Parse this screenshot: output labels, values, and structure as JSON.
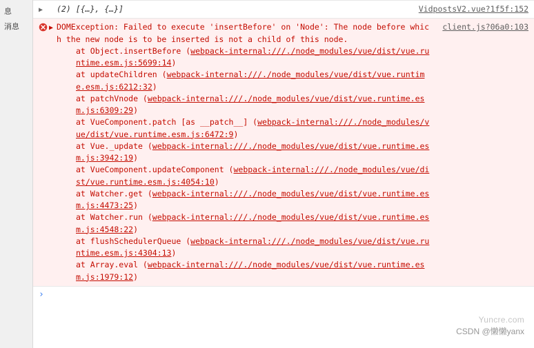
{
  "sidebar": {
    "label_line1": "息",
    "label_line2": "消息"
  },
  "log_row": {
    "count_prefix": "(2)",
    "summary": "[{…}, {…}]",
    "source": "VidpostsV2.vue?1f5f:152"
  },
  "error": {
    "source": "client.js?06a0:103",
    "header_plain": "DOMException: Failed to execute 'insertBefore' on 'Node': The node before which the new node is to be inserted is not a child of this node.",
    "trace": [
      {
        "at": "at Object.insertBefore (",
        "link": "webpack-internal:///./node_modules/vue/dist/vue.runtime.esm.js:5699:14",
        "tail": ")"
      },
      {
        "at": "at updateChildren (",
        "link": "webpack-internal:///./node_modules/vue/dist/vue.runtime.esm.js:6212:32",
        "tail": ")"
      },
      {
        "at": "at patchVnode (",
        "link": "webpack-internal:///./node_modules/vue/dist/vue.runtime.esm.js:6309:29",
        "tail": ")"
      },
      {
        "at": "at VueComponent.patch [as __patch__] (",
        "link": "webpack-internal:///./node_modules/vue/dist/vue.runtime.esm.js:6472:9",
        "tail": ")"
      },
      {
        "at": "at Vue._update (",
        "link": "webpack-internal:///./node_modules/vue/dist/vue.runtime.esm.js:3942:19",
        "tail": ")"
      },
      {
        "at": "at VueComponent.updateComponent (",
        "link": "webpack-internal:///./node_modules/vue/dist/vue.runtime.esm.js:4054:10",
        "tail": ")"
      },
      {
        "at": "at Watcher.get (",
        "link": "webpack-internal:///./node_modules/vue/dist/vue.runtime.esm.js:4473:25",
        "tail": ")"
      },
      {
        "at": "at Watcher.run (",
        "link": "webpack-internal:///./node_modules/vue/dist/vue.runtime.esm.js:4548:22",
        "tail": ")"
      },
      {
        "at": "at flushSchedulerQueue (",
        "link": "webpack-internal:///./node_modules/vue/dist/vue.runtime.esm.js:4304:13",
        "tail": ")"
      },
      {
        "at": "at Array.eval (",
        "link": "webpack-internal:///./node_modules/vue/dist/vue.runtime.esm.js:1979:12",
        "tail": ")"
      }
    ]
  },
  "prompt": "›",
  "watermark1": "Yuncre.com",
  "watermark2": "CSDN @懒懒yanx"
}
